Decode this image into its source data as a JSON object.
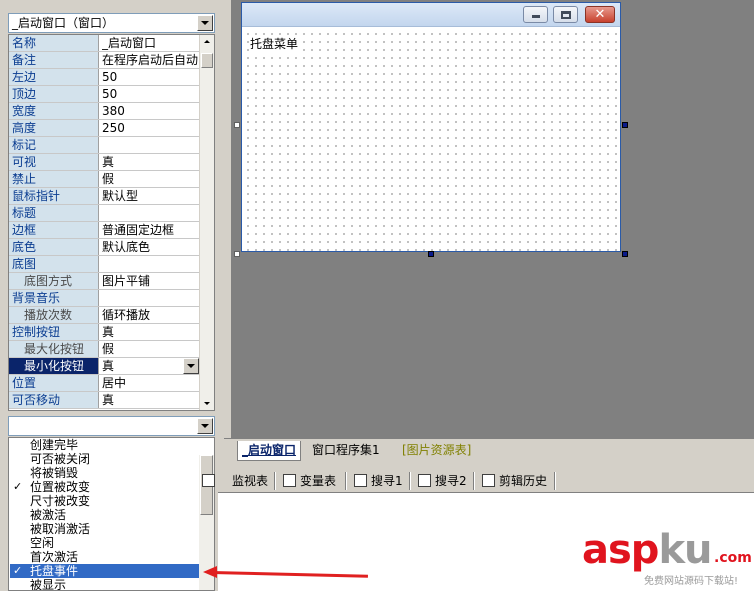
{
  "window_selector": {
    "value": "_启动窗口（窗口）"
  },
  "properties": [
    {
      "name": "名称",
      "value": "_启动窗口"
    },
    {
      "name": "备注",
      "value": "在程序启动后自动"
    },
    {
      "name": "左边",
      "value": "50"
    },
    {
      "name": "顶边",
      "value": "50"
    },
    {
      "name": "宽度",
      "value": "380"
    },
    {
      "name": "高度",
      "value": "250"
    },
    {
      "name": "标记",
      "value": ""
    },
    {
      "name": "可视",
      "value": "真"
    },
    {
      "name": "禁止",
      "value": "假"
    },
    {
      "name": "鼠标指针",
      "value": "默认型"
    },
    {
      "name": "标题",
      "value": ""
    },
    {
      "name": "边框",
      "value": "普通固定边框"
    },
    {
      "name": "底色",
      "value": "默认底色"
    },
    {
      "name": "底图",
      "value": ""
    },
    {
      "name": "底图方式",
      "value": "图片平铺"
    },
    {
      "name": "背景音乐",
      "value": ""
    },
    {
      "name": "播放次数",
      "value": "循环播放"
    },
    {
      "name": "控制按钮",
      "value": "真"
    },
    {
      "name": "最大化按钮",
      "value": "假"
    },
    {
      "name": "最小化按钮",
      "value": "真"
    },
    {
      "name": "位置",
      "value": "居中"
    },
    {
      "name": "可否移动",
      "value": "真"
    }
  ],
  "events": [
    {
      "label": "创建完毕",
      "checked": false
    },
    {
      "label": "可否被关闭",
      "checked": false
    },
    {
      "label": "将被销毁",
      "checked": false
    },
    {
      "label": "位置被改变",
      "checked": true
    },
    {
      "label": "尺寸被改变",
      "checked": false
    },
    {
      "label": "被激活",
      "checked": false
    },
    {
      "label": "被取消激活",
      "checked": false
    },
    {
      "label": "空闲",
      "checked": false
    },
    {
      "label": "首次激活",
      "checked": false
    },
    {
      "label": "托盘事件",
      "checked": true
    },
    {
      "label": "被显示",
      "checked": false
    }
  ],
  "check_mark": "✓",
  "form": {
    "label": "托盘菜单"
  },
  "tabs": [
    "_启动窗口",
    "窗口程序集1",
    "[图片资源表]"
  ],
  "bottom_tabs": [
    "监视表",
    "变量表",
    "搜寻1",
    "搜寻2",
    "剪辑历史"
  ],
  "watermark": {
    "logo_red": "asp",
    "logo_gray": "ku",
    "suffix": ".com",
    "subtitle": "免费网站源码下载站!"
  },
  "colors": {
    "arrow": "#e02020",
    "selection": "#316ac5",
    "title_gradient_top": "#dce8f7"
  }
}
